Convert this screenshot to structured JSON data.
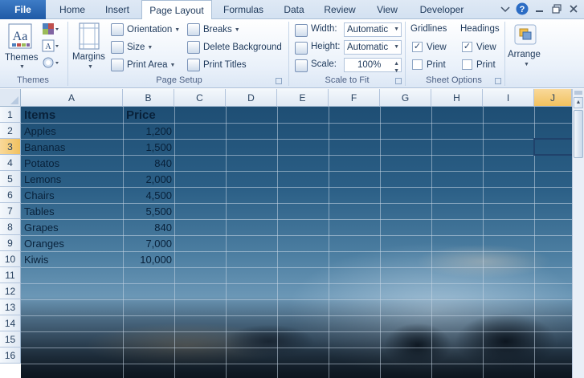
{
  "tabs": {
    "file": "File",
    "items": [
      "Home",
      "Insert",
      "Page Layout",
      "Formulas",
      "Data",
      "Review",
      "View",
      "Developer"
    ],
    "active": "Page Layout"
  },
  "ribbon": {
    "themes": {
      "themes_label": "Themes",
      "group_label": "Themes"
    },
    "page_setup": {
      "margins": "Margins",
      "orientation": "Orientation",
      "size": "Size",
      "print_area": "Print Area",
      "breaks": "Breaks",
      "delete_background": "Delete Background",
      "print_titles": "Print Titles",
      "group_label": "Page Setup"
    },
    "scale_to_fit": {
      "width_label": "Width:",
      "width_value": "Automatic",
      "height_label": "Height:",
      "height_value": "Automatic",
      "scale_label": "Scale:",
      "scale_value": "100%",
      "group_label": "Scale to Fit"
    },
    "sheet_options": {
      "gridlines": "Gridlines",
      "headings": "Headings",
      "view": "View",
      "print": "Print",
      "gridlines_view_checked": true,
      "gridlines_print_checked": false,
      "headings_view_checked": true,
      "headings_print_checked": false,
      "group_label": "Sheet Options"
    },
    "arrange": {
      "arrange_label": "Arrange"
    }
  },
  "sheet": {
    "columns": [
      "A",
      "B",
      "C",
      "D",
      "E",
      "F",
      "G",
      "H",
      "I",
      "J"
    ],
    "rows": [
      "1",
      "2",
      "3",
      "4",
      "5",
      "6",
      "7",
      "8",
      "9",
      "10",
      "11",
      "12",
      "13",
      "14",
      "15",
      "16"
    ],
    "selected_column": "J",
    "selected_row": "3",
    "header": {
      "items": "Items",
      "price": "Price"
    },
    "data": [
      {
        "item": "Apples",
        "price": "1,200"
      },
      {
        "item": "Bananas",
        "price": "1,500"
      },
      {
        "item": "Potatos",
        "price": "840"
      },
      {
        "item": "Lemons",
        "price": "2,000"
      },
      {
        "item": "Chairs",
        "price": "4,500"
      },
      {
        "item": "Tables",
        "price": "5,500"
      },
      {
        "item": "Grapes",
        "price": "840"
      },
      {
        "item": "Oranges",
        "price": "7,000"
      },
      {
        "item": "Kiwis",
        "price": "10,000"
      }
    ]
  },
  "colors": {
    "accent": "#2b579a",
    "selected_header": "#f1c15f",
    "file_tab": "#2a64b0"
  }
}
